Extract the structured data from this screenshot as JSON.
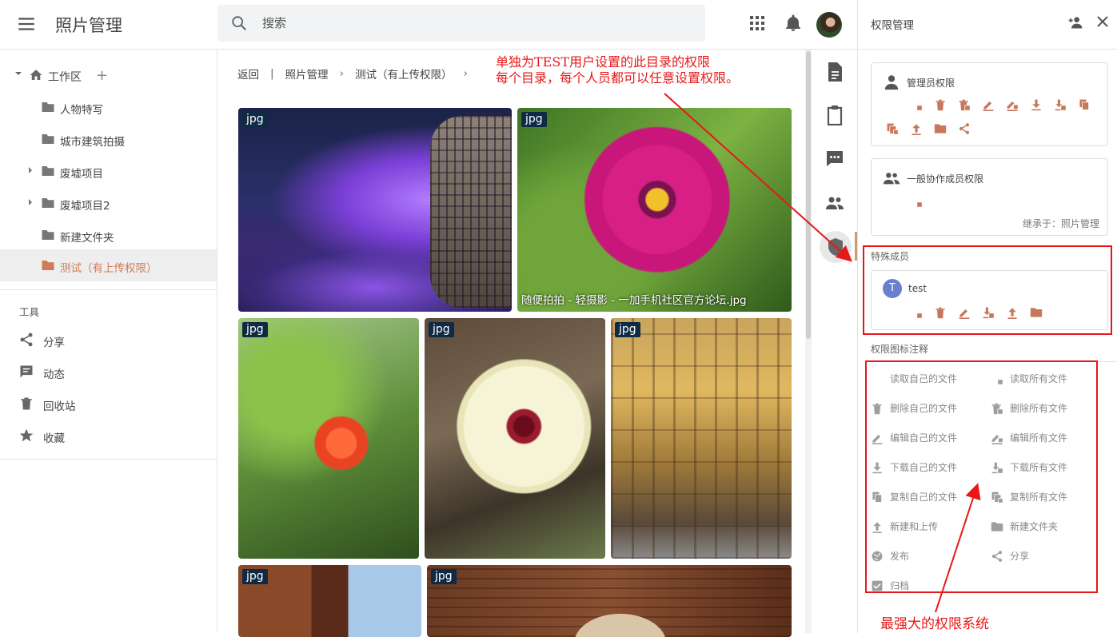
{
  "header": {
    "app_title": "照片管理",
    "search_placeholder": "搜索"
  },
  "sidebar": {
    "workspace": "工作区",
    "folders": [
      {
        "label": "人物特写",
        "expandable": false
      },
      {
        "label": "城市建筑拍摄",
        "expandable": false
      },
      {
        "label": "废墟项目",
        "expandable": true
      },
      {
        "label": "废墟项目2",
        "expandable": true
      },
      {
        "label": "新建文件夹",
        "expandable": false
      },
      {
        "label": "测试（有上传权限）",
        "expandable": false,
        "active": true
      }
    ],
    "tools_title": "工具",
    "tools": [
      {
        "label": "分享",
        "icon": "share-icon"
      },
      {
        "label": "动态",
        "icon": "activity-icon"
      },
      {
        "label": "回收站",
        "icon": "trash-icon"
      },
      {
        "label": "收藏",
        "icon": "star-icon"
      }
    ]
  },
  "breadcrumb": {
    "back": "返回",
    "items": [
      "照片管理",
      "测试（有上传权限）"
    ]
  },
  "photos": [
    {
      "tag": "jpg",
      "caption": ""
    },
    {
      "tag": "jpg",
      "caption": "随便拍拍 - 轻摄影 - 一加手机社区官方论坛.jpg"
    },
    {
      "tag": "jpg",
      "caption": ""
    },
    {
      "tag": "jpg",
      "caption": ""
    },
    {
      "tag": "jpg",
      "caption": ""
    },
    {
      "tag": "jpg",
      "caption": ""
    },
    {
      "tag": "jpg",
      "caption": ""
    }
  ],
  "annotations": {
    "top_line1": "单独为TEST用户设置的此目录的权限",
    "top_line2": "每个目录，每个人员都可以任意设置权限。",
    "bottom": "最强大的权限系统"
  },
  "panel": {
    "title": "权限管理",
    "admin_label": "管理员权限",
    "member_label": "一般协作成员权限",
    "inherit_text": "继承于：照片管理",
    "special_title": "特殊成员",
    "special_user": {
      "initial": "T",
      "name": "test"
    },
    "legend_title": "权限图标注释",
    "legend": [
      {
        "icon": "eye-icon",
        "label": "读取自己的文件"
      },
      {
        "icon": "eye-all-icon",
        "label": "读取所有文件"
      },
      {
        "icon": "delete-icon",
        "label": "删除自己的文件"
      },
      {
        "icon": "delete-all-icon",
        "label": "删除所有文件"
      },
      {
        "icon": "edit-icon",
        "label": "编辑自己的文件"
      },
      {
        "icon": "edit-all-icon",
        "label": "编辑所有文件"
      },
      {
        "icon": "download-icon",
        "label": "下载自己的文件"
      },
      {
        "icon": "download-all-icon",
        "label": "下载所有文件"
      },
      {
        "icon": "copy-icon",
        "label": "复制自己的文件"
      },
      {
        "icon": "copy-all-icon",
        "label": "复制所有文件"
      },
      {
        "icon": "upload-icon",
        "label": "新建和上传"
      },
      {
        "icon": "new-folder-icon",
        "label": "新建文件夹"
      },
      {
        "icon": "publish-icon",
        "label": "发布"
      },
      {
        "icon": "share-icon",
        "label": "分享"
      },
      {
        "icon": "archive-icon",
        "label": "归档"
      }
    ]
  },
  "colors": {
    "accent": "#c8775a",
    "annotation_red": "#e81818",
    "active_folder": "#d07a56"
  }
}
